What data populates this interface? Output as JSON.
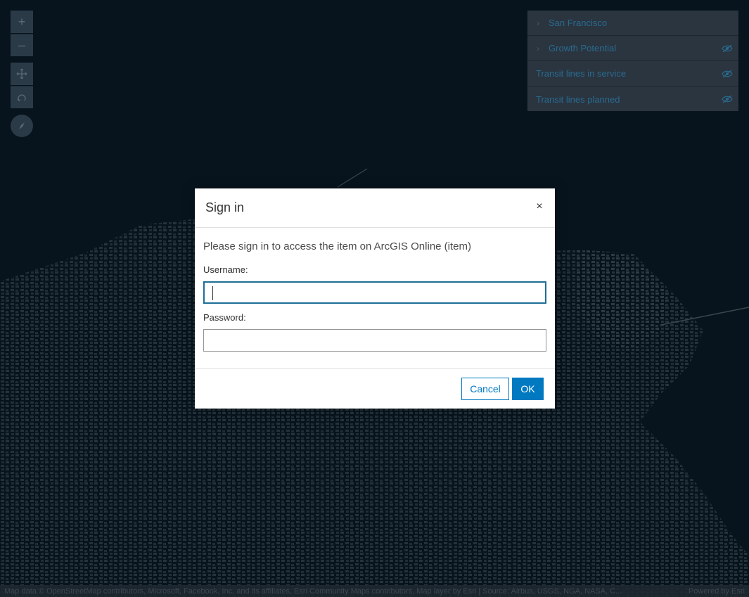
{
  "map": {
    "zoom_in_label": "+",
    "zoom_out_label": "–",
    "pan_icon": "move-icon",
    "rotate_icon": "rotate-icon",
    "compass_icon": "compass-icon",
    "background_color": "#0b1f2e"
  },
  "layer_list": {
    "items": [
      {
        "label": "San Francisco",
        "has_chevron": true,
        "has_eye": false
      },
      {
        "label": "Growth Potential",
        "has_chevron": true,
        "has_eye": true
      },
      {
        "label": "Transit lines in service",
        "has_chevron": false,
        "has_eye": true
      },
      {
        "label": "Transit lines planned",
        "has_chevron": false,
        "has_eye": true
      }
    ]
  },
  "attribution": {
    "text": "Map data © OpenStreetMap contributors, Microsoft, Facebook, Inc. and its affiliates, Esri Community Maps contributors, Map layer by Esri | Source: Airbus, USGS, NGA, NASA, C...",
    "powered_by": "Powered by Esri"
  },
  "dialog": {
    "title": "Sign in",
    "close_label": "×",
    "message": "Please sign in to access the item on ArcGIS Online (item)",
    "username_label": "Username:",
    "username_value": "",
    "password_label": "Password:",
    "password_value": "",
    "cancel_label": "Cancel",
    "ok_label": "OK",
    "accent_color": "#0079c1"
  }
}
